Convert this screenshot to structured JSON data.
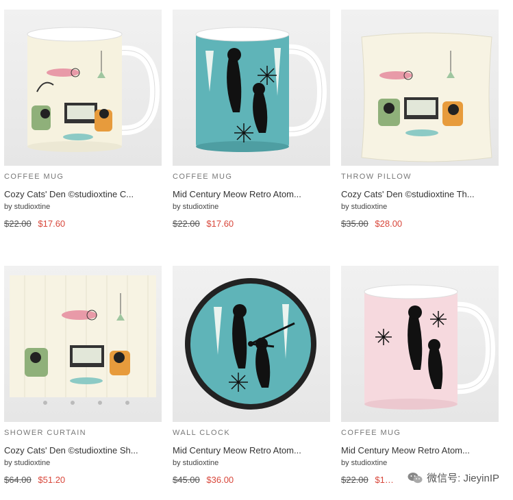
{
  "products": [
    {
      "category": "COFFEE MUG",
      "title": "Cozy Cats' Den ©studioxtine C...",
      "artist": "by studioxtine",
      "old_price": "$22.00",
      "new_price": "$17.60",
      "image": "mug-cream-den"
    },
    {
      "category": "COFFEE MUG",
      "title": "Mid Century Meow Retro Atom...",
      "artist": "by studioxtine",
      "old_price": "$22.00",
      "new_price": "$17.60",
      "image": "mug-teal-cats"
    },
    {
      "category": "THROW PILLOW",
      "title": "Cozy Cats' Den ©studioxtine Th...",
      "artist": "by studioxtine",
      "old_price": "$35.00",
      "new_price": "$28.00",
      "image": "pillow-cream-den"
    },
    {
      "category": "SHOWER CURTAIN",
      "title": "Cozy Cats' Den ©studioxtine Sh...",
      "artist": "by studioxtine",
      "old_price": "$64.00",
      "new_price": "$51.20",
      "image": "curtain-cream-den"
    },
    {
      "category": "WALL CLOCK",
      "title": "Mid Century Meow Retro Atom...",
      "artist": "by studioxtine",
      "old_price": "$45.00",
      "new_price": "$36.00",
      "image": "clock-teal-cats"
    },
    {
      "category": "COFFEE MUG",
      "title": "Mid Century Meow Retro Atom...",
      "artist": "by studioxtine",
      "old_price": "$22.00",
      "new_price": "$1…",
      "image": "mug-pink-cats"
    }
  ],
  "watermark": {
    "text": "微信号: JieyinIP",
    "icon": "wechat-icon"
  },
  "colors": {
    "sale": "#d8463a",
    "teal": "#5fb4b8",
    "cream": "#f7f3e3",
    "pink": "#f6d9de"
  }
}
